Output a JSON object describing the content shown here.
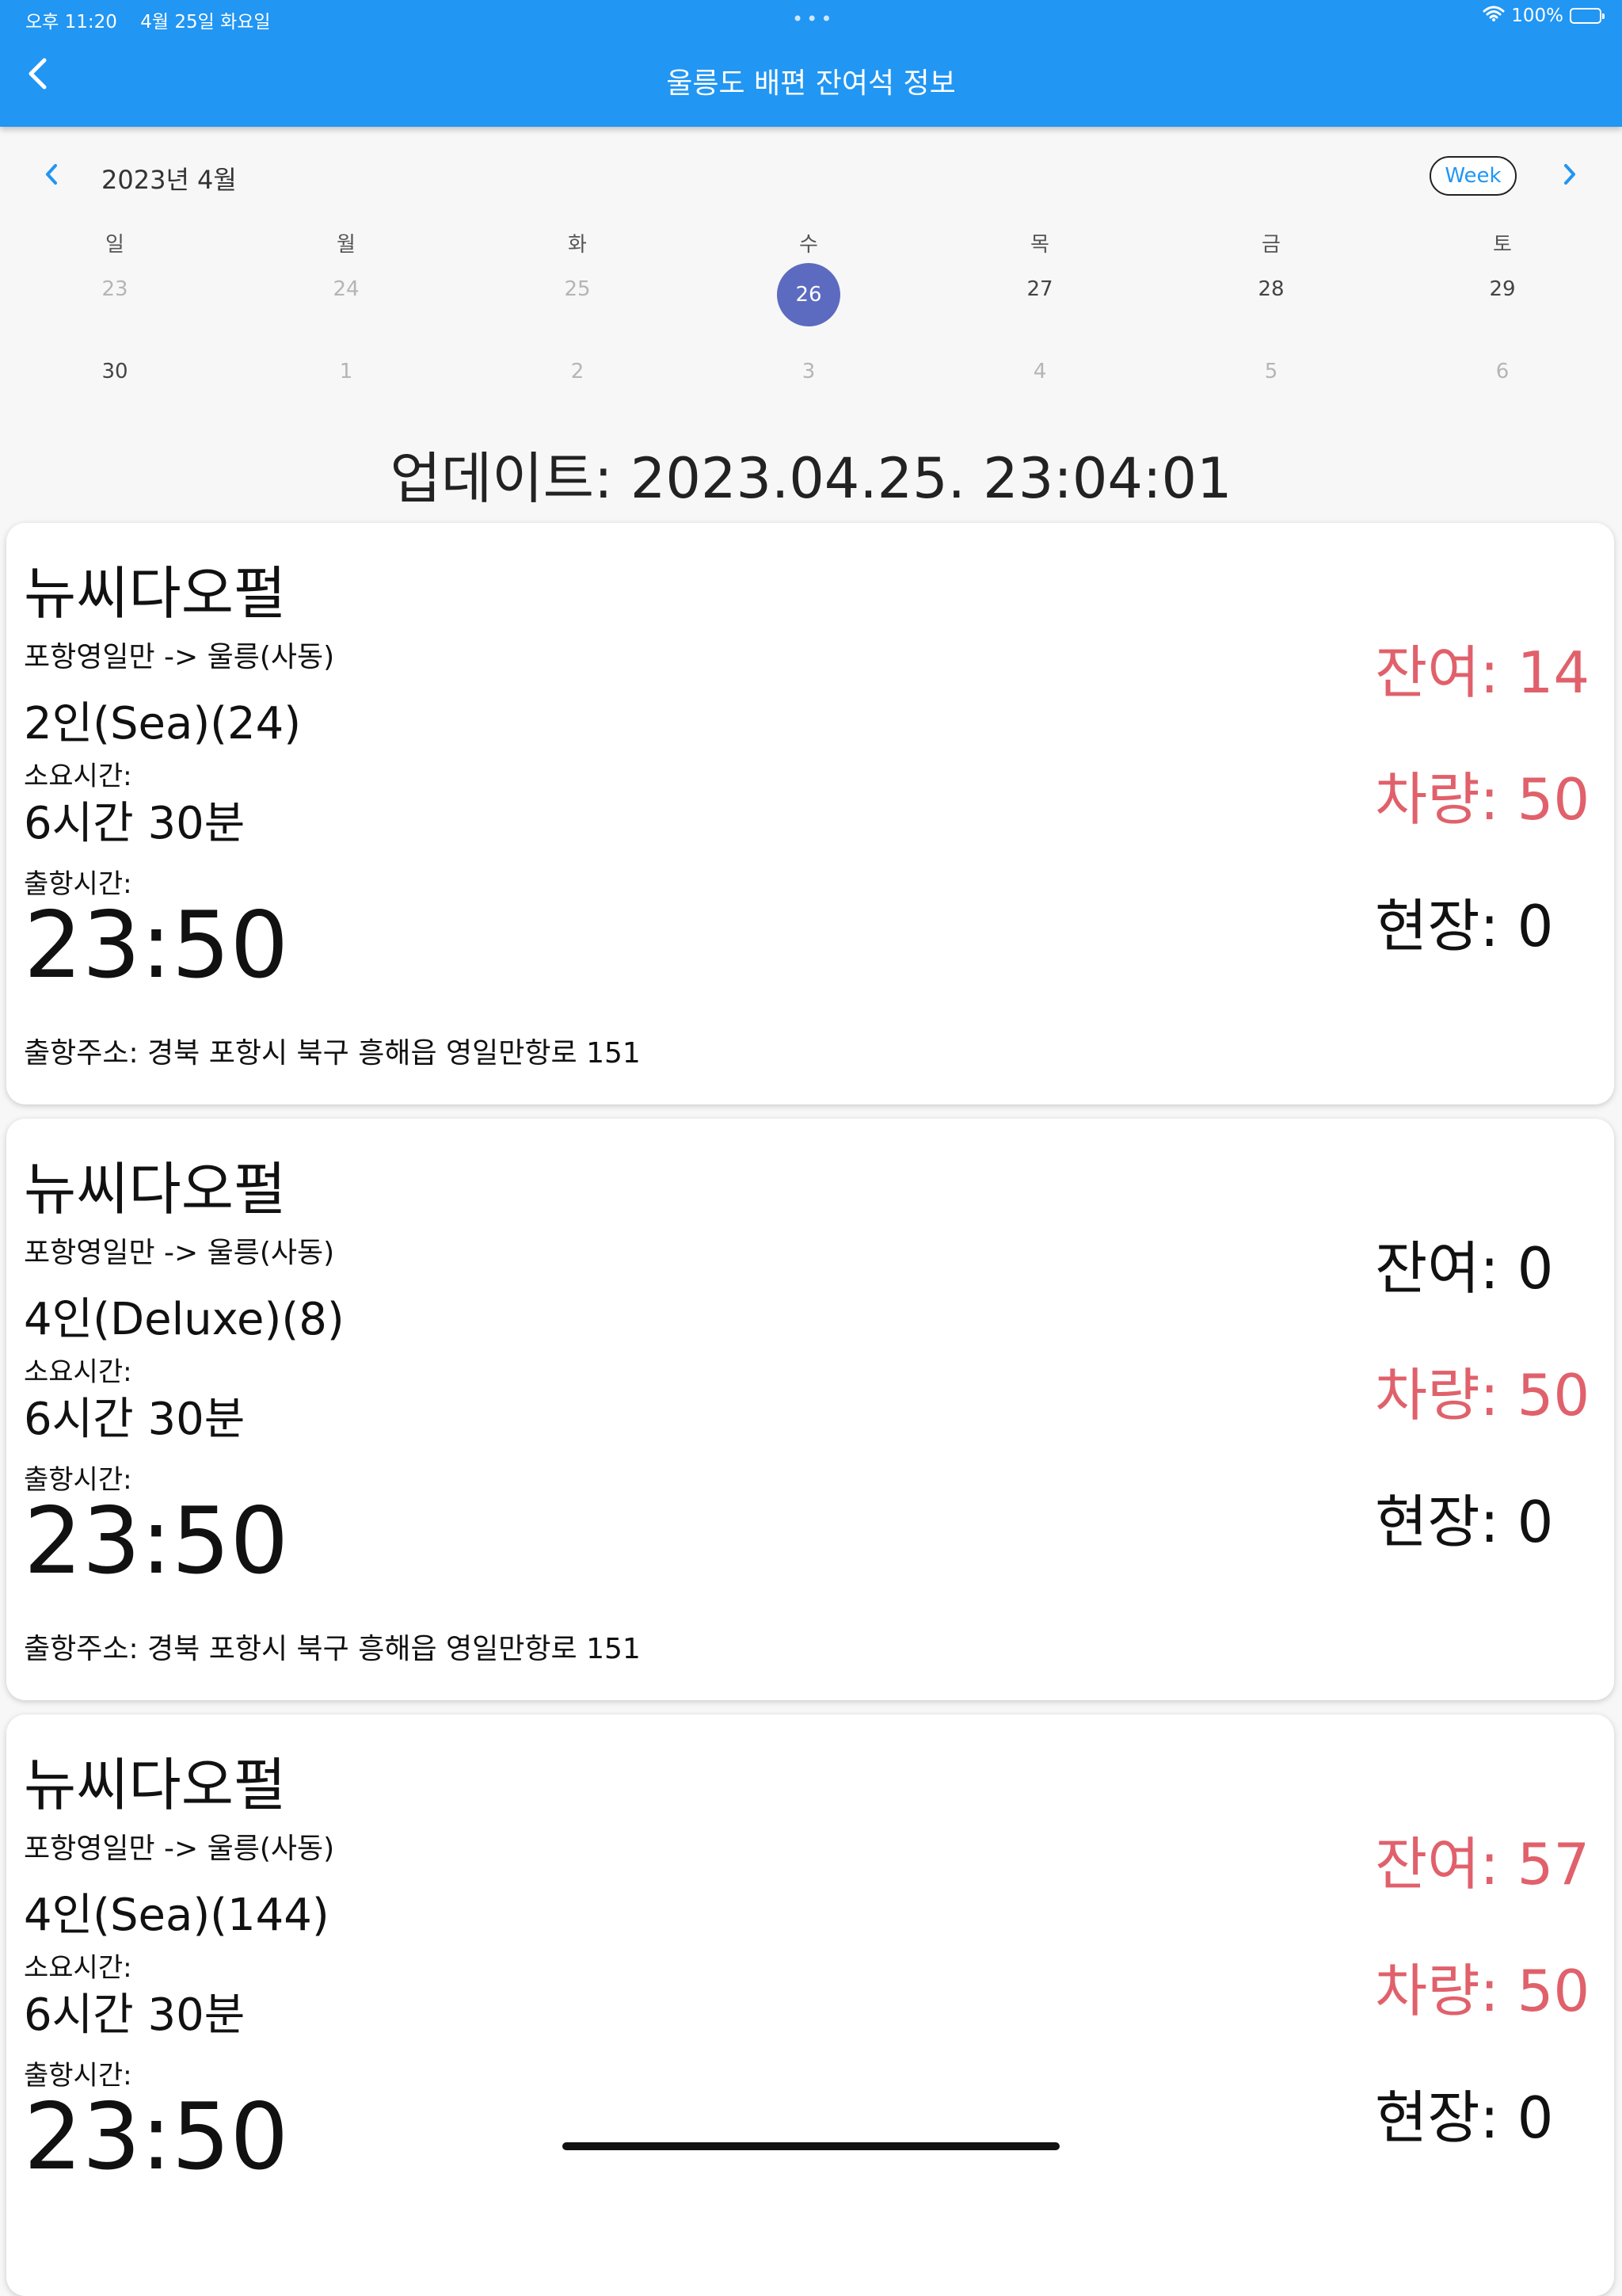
{
  "status_bar": {
    "time": "오후 11:20",
    "date": "4월 25일 화요일",
    "dots": "•••",
    "battery_text": "100%",
    "battery_level": 1.0
  },
  "app_bar": {
    "title": "울릉도 배편 잔여석 정보",
    "back_icon": "chevron-left-icon"
  },
  "calendar": {
    "month_label": "2023년 4월",
    "format_button": "Week",
    "weekdays": [
      "일",
      "월",
      "화",
      "수",
      "목",
      "금",
      "토"
    ],
    "week1": [
      "23",
      "24",
      "25",
      "26",
      "27",
      "28",
      "29"
    ],
    "week2": [
      "30",
      "1",
      "2",
      "3",
      "4",
      "5",
      "6"
    ],
    "selected": "26",
    "selected_color": "#5c6bc0"
  },
  "updated_text": "업데이트: 2023.04.25. 23:04:01",
  "ships": [
    {
      "name": "뉴씨다오펄",
      "route": "포항영일만 -> 울릉(사동)",
      "seat": "2인(Sea)(24)",
      "duration_label": "소요시간:",
      "duration": "6시간 30분",
      "departure_label": "출항시간:",
      "departure": "23:50",
      "address": "출항주소: 경북 포항시 북구 흥해읍 영일만항로 151",
      "remaining": "잔여: 14",
      "vehicle": "차량: 50",
      "onsite": "현장: 0"
    },
    {
      "name": "뉴씨다오펄",
      "route": "포항영일만 -> 울릉(사동)",
      "seat": "4인(Deluxe)(8)",
      "duration_label": "소요시간:",
      "duration": "6시간 30분",
      "departure_label": "출항시간:",
      "departure": "23:50",
      "address": "출항주소: 경북 포항시 북구 흥해읍 영일만항로 151",
      "remaining": "잔여: 0",
      "vehicle": "차량: 50",
      "onsite": "현장: 0"
    },
    {
      "name": "뉴씨다오펄",
      "route": "포항영일만 -> 울릉(사동)",
      "seat": "4인(Sea)(144)",
      "duration_label": "소요시간:",
      "duration": "6시간 30분",
      "departure_label": "출항시간:",
      "departure": "23:50",
      "remaining": "잔여: 57",
      "vehicle": "차량: 50",
      "onsite": "현장: 0"
    }
  ],
  "colors": {
    "app_bar": "#2196f3",
    "available": "#e0616b",
    "unavailable": "#111111"
  }
}
